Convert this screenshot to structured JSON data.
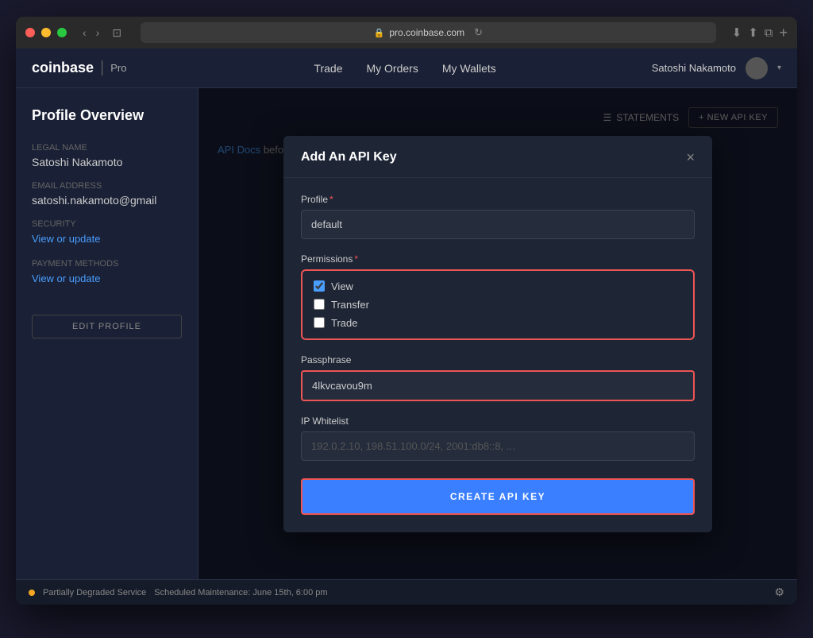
{
  "window": {
    "url": "pro.coinbase.com"
  },
  "navbar": {
    "logo": "coinbase",
    "pro_label": "Pro",
    "nav_links": [
      {
        "label": "Trade",
        "id": "trade"
      },
      {
        "label": "My Orders",
        "id": "my-orders"
      },
      {
        "label": "My Wallets",
        "id": "my-wallets"
      }
    ],
    "user_name": "Satoshi Nakamoto"
  },
  "sidebar": {
    "title": "Profile Overview",
    "legal_name_label": "Legal name",
    "legal_name_value": "Satoshi Nakamoto",
    "email_label": "Email address",
    "email_value": "satoshi.nakamoto@gmail",
    "security_label": "Security",
    "security_link": "View or update",
    "payment_label": "Payment Methods",
    "payment_link": "View or update",
    "edit_btn": "EDIT PROFILE"
  },
  "main": {
    "statements_label": "STATEMENTS",
    "new_api_btn": "+ NEW API KEY",
    "api_docs_text": "API Docs",
    "api_docs_suffix": "before"
  },
  "modal": {
    "title": "Add An API Key",
    "close_btn": "×",
    "profile_label": "Profile",
    "profile_value": "default",
    "permissions_label": "Permissions",
    "permissions": [
      {
        "label": "View",
        "checked": true
      },
      {
        "label": "Transfer",
        "checked": false
      },
      {
        "label": "Trade",
        "checked": false
      }
    ],
    "passphrase_label": "Passphrase",
    "passphrase_value": "4lkvcavou9m",
    "ip_whitelist_label": "IP Whitelist",
    "ip_whitelist_placeholder": "192.0.2.10, 198.51.100.0/24, 2001:db8::8, ...",
    "create_btn_label": "CREATE API KEY"
  },
  "status": {
    "dot_color": "#f5a623",
    "degraded_text": "Partially Degraded Service",
    "maintenance_text": "Scheduled Maintenance: June 15th, 6:00 pm"
  }
}
